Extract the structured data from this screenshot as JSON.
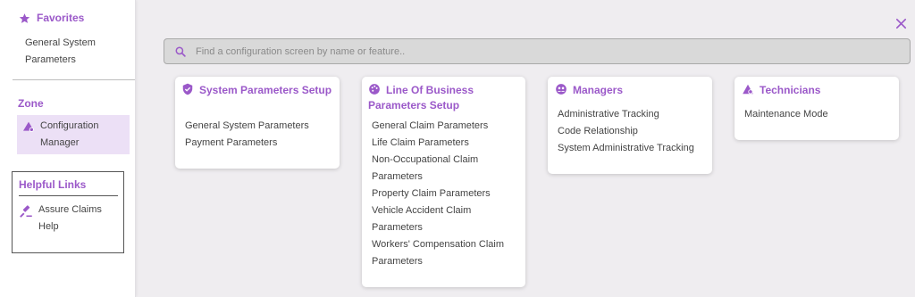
{
  "sidebar": {
    "favorites": {
      "title": "Favorites",
      "items": [
        "General System Parameters"
      ]
    },
    "zone": {
      "title": "Zone",
      "items": [
        "Configuration Manager"
      ]
    },
    "helpful_links": {
      "title": "Helpful Links",
      "items": [
        "Assure Claims Help"
      ]
    }
  },
  "search": {
    "placeholder": "Find a configuration screen by name or feature.."
  },
  "cards": [
    {
      "title": "System Parameters Setup",
      "icon": "shield-check-icon",
      "items": [
        "General System Parameters",
        "Payment Parameters"
      ]
    },
    {
      "title": "Line Of Business Parameters Setup",
      "icon": "palette-icon",
      "items": [
        "General Claim Parameters",
        "Life Claim Parameters",
        "Non-Occupational Claim Parameters",
        "Property Claim Parameters",
        "Vehicle Accident Claim Parameters",
        "Workers' Compensation Claim Parameters"
      ]
    },
    {
      "title": "Managers",
      "icon": "users-icon",
      "items": [
        "Administrative Tracking",
        "Code Relationship",
        "System Administrative Tracking"
      ]
    },
    {
      "title": "Technicians",
      "icon": "tools-icon",
      "items": [
        "Maintenance Mode"
      ]
    }
  ],
  "colors": {
    "accent": "#9b59c9",
    "selected_bg": "#ece0f6",
    "page_bg": "#efedf0"
  }
}
